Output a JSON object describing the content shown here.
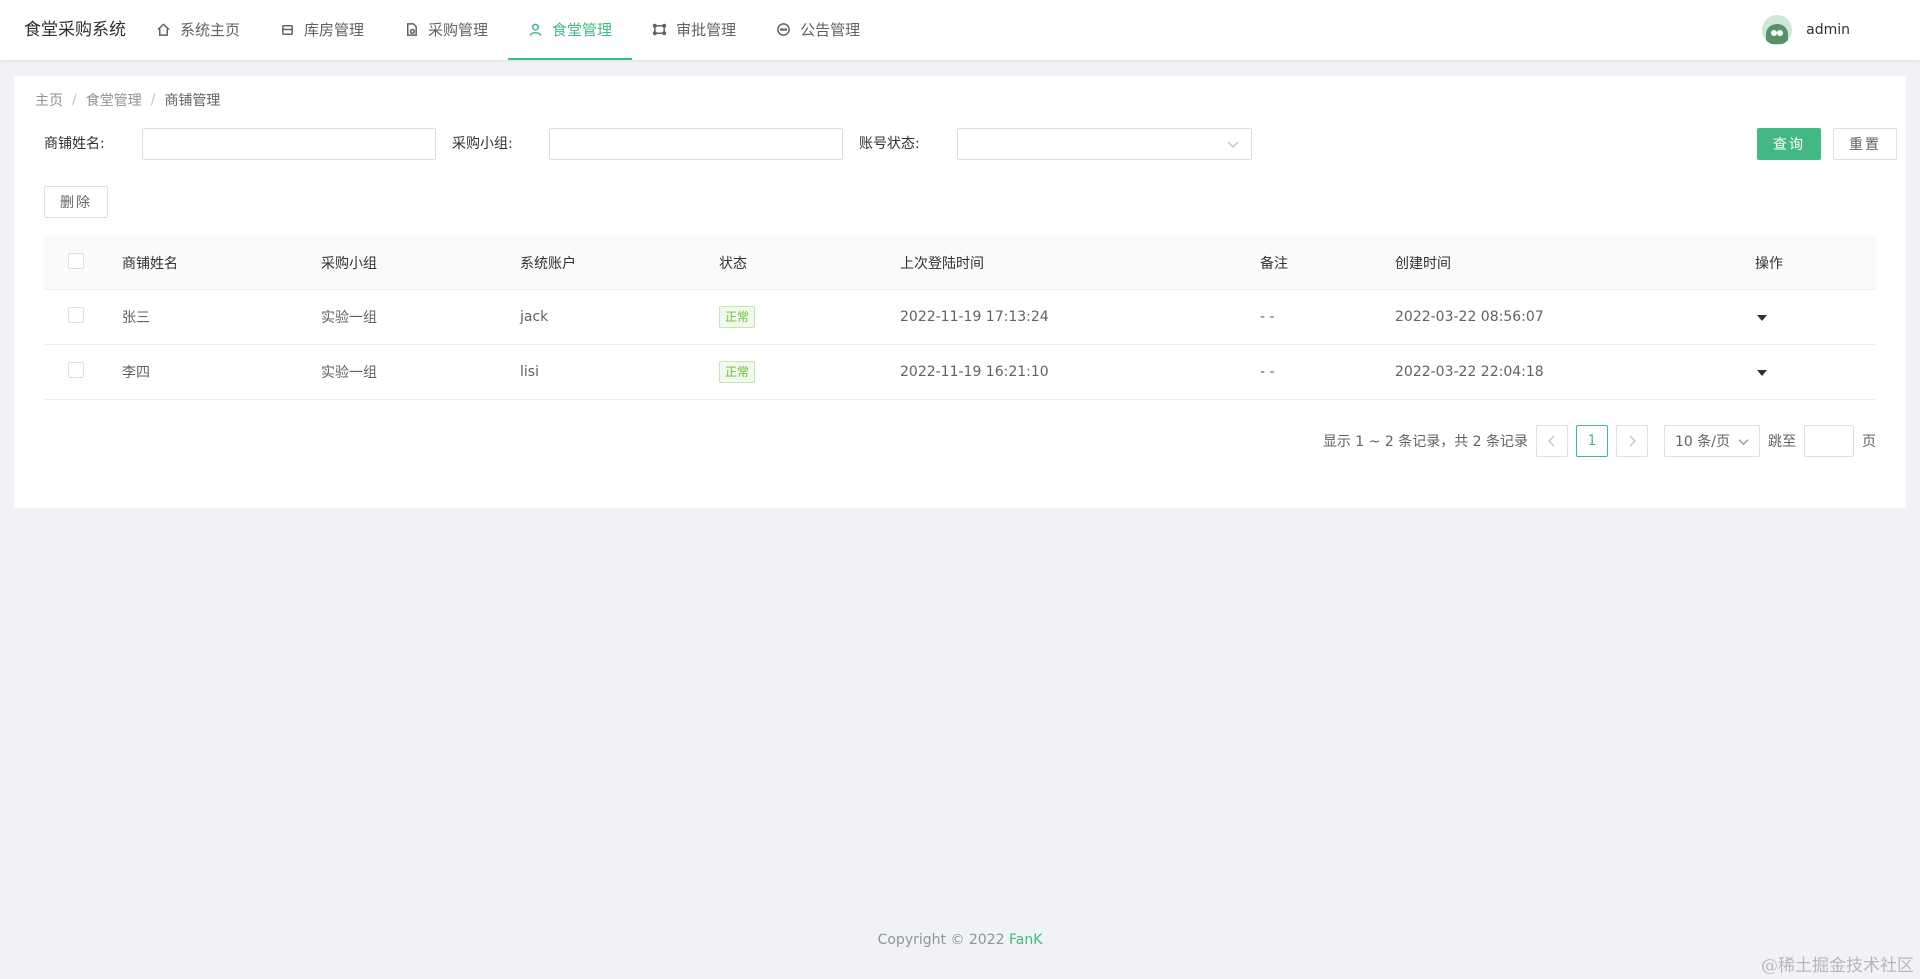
{
  "app": {
    "title": "食堂采购系统"
  },
  "nav": {
    "items": [
      {
        "label": "系统主页",
        "icon": "home-icon"
      },
      {
        "label": "库房管理",
        "icon": "box-icon"
      },
      {
        "label": "采购管理",
        "icon": "document-icon"
      },
      {
        "label": "食堂管理",
        "icon": "user-icon",
        "active": true
      },
      {
        "label": "审批管理",
        "icon": "frame-icon"
      },
      {
        "label": "公告管理",
        "icon": "chat-icon"
      }
    ],
    "accent": "#42b983"
  },
  "user": {
    "name": "admin",
    "avatar_icon": "avatar-icon"
  },
  "breadcrumb": [
    "主页",
    "食堂管理",
    "商铺管理"
  ],
  "breadcrumb_separator": "/",
  "filters": {
    "shop_name_label": "商铺姓名:",
    "shop_name_value": "",
    "group_label": "采购小组:",
    "group_value": "",
    "status_label": "账号状态:",
    "status_value": "",
    "query_label": "查询",
    "reset_label": "重置"
  },
  "toolbar": {
    "delete_label": "删除"
  },
  "table": {
    "columns": [
      "商铺姓名",
      "采购小组",
      "系统账户",
      "状态",
      "上次登陆时间",
      "备注",
      "创建时间",
      "操作"
    ],
    "rows": [
      {
        "name": "张三",
        "group": "实验一组",
        "account": "jack",
        "status": "正常",
        "last_login": "2022-11-19 17:13:24",
        "note": "- -",
        "created": "2022-03-22 08:56:07"
      },
      {
        "name": "李四",
        "group": "实验一组",
        "account": "lisi",
        "status": "正常",
        "last_login": "2022-11-19 16:21:10",
        "note": "- -",
        "created": "2022-03-22 22:04:18"
      }
    ],
    "status_color": "#67c23a"
  },
  "pagination": {
    "total_text": "显示 1 ~ 2 条记录，共 2 条记录",
    "current_page": "1",
    "page_size": "10 条/页",
    "jump_label": "跳至",
    "page_suffix": "页"
  },
  "footer": {
    "copyright": "Copyright © 2022",
    "author": "FanK"
  },
  "watermark": "@稀土掘金技术社区"
}
